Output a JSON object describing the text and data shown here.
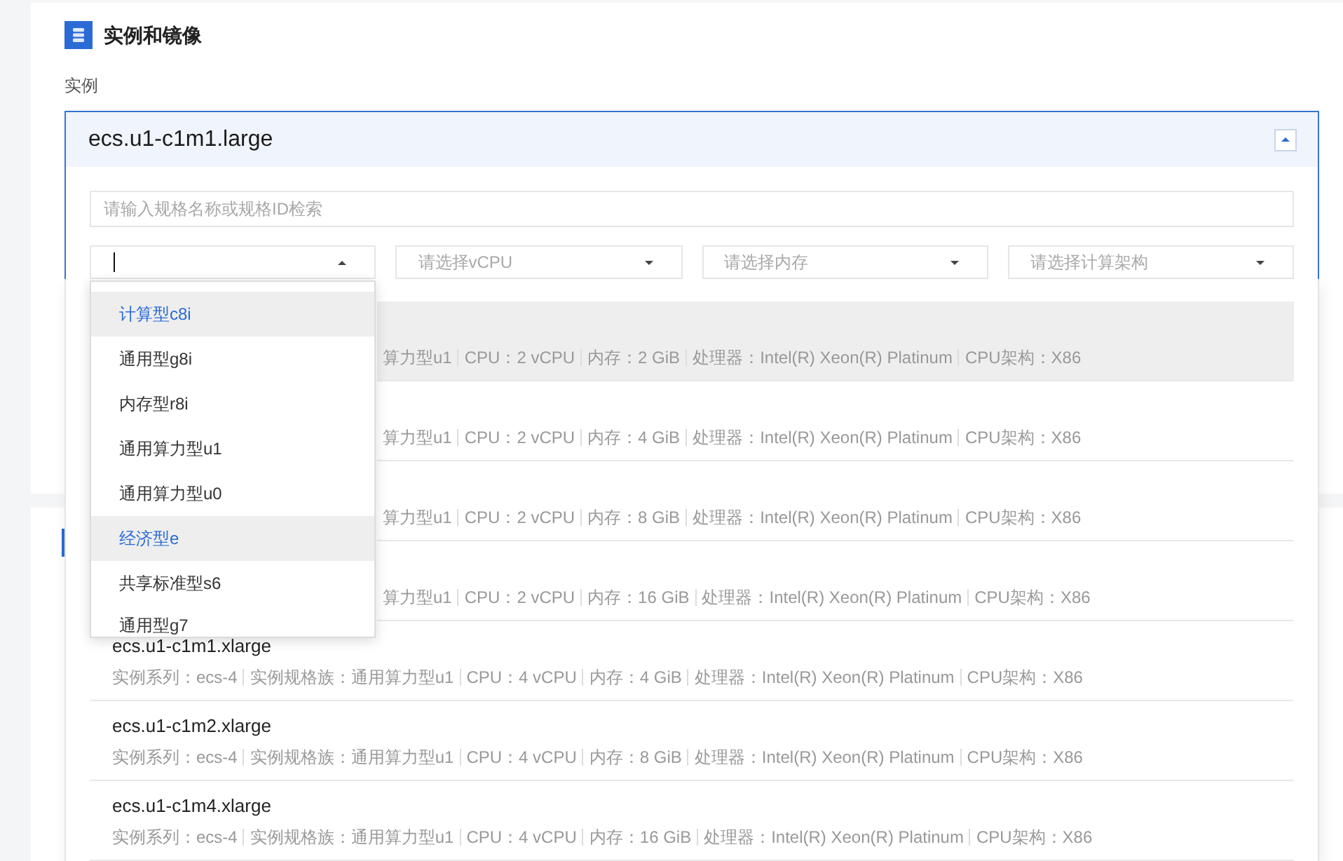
{
  "section": {
    "title": "实例和镜像"
  },
  "field_label": "实例",
  "spec_picker": {
    "value": "ecs.u1-c1m1.large",
    "expanded": true,
    "search": {
      "placeholder": "请输入规格名称或规格ID检索"
    },
    "filters": [
      {
        "focused": true,
        "open": true,
        "options": [
          {
            "label": "计算型c8i",
            "selected": true
          },
          {
            "label": "通用型g8i",
            "selected": false
          },
          {
            "label": "内存型r8i",
            "selected": false
          },
          {
            "label": "通用算力型u1",
            "selected": false
          },
          {
            "label": "通用算力型u0",
            "selected": false
          },
          {
            "label": "经济型e",
            "selected": true
          },
          {
            "label": "共享标准型s6",
            "selected": false
          },
          {
            "label": "通用型g7",
            "selected": false
          }
        ]
      },
      {
        "placeholder": "请选择vCPU",
        "focused": false,
        "open": false
      },
      {
        "placeholder": "请选择内存",
        "focused": false,
        "open": false
      },
      {
        "placeholder": "请选择计算架构",
        "focused": false,
        "open": false
      }
    ],
    "specs": [
      {
        "hovered": true,
        "fields": [
          "算力型u1",
          "CPU：2 vCPU",
          "内存：2 GiB",
          "处理器：Intel(R) Xeon(R) Platinum",
          "CPU架构：X86"
        ]
      },
      {
        "hovered": false,
        "fields": [
          "算力型u1",
          "CPU：2 vCPU",
          "内存：4 GiB",
          "处理器：Intel(R) Xeon(R) Platinum",
          "CPU架构：X86"
        ]
      },
      {
        "hovered": false,
        "fields": [
          "算力型u1",
          "CPU：2 vCPU",
          "内存：8 GiB",
          "处理器：Intel(R) Xeon(R) Platinum",
          "CPU架构：X86"
        ]
      },
      {
        "hovered": false,
        "fields": [
          "算力型u1",
          "CPU：2 vCPU",
          "内存：16 GiB",
          "处理器：Intel(R) Xeon(R) Platinum",
          "CPU架构：X86"
        ]
      },
      {
        "name": "ecs.u1-c1m1.xlarge",
        "hovered": false,
        "fields": [
          "实例系列：ecs-4",
          "实例规格族：通用算力型u1",
          "CPU：4 vCPU",
          "内存：4 GiB",
          "处理器：Intel(R) Xeon(R) Platinum",
          "CPU架构：X86"
        ]
      },
      {
        "name": "ecs.u1-c1m2.xlarge",
        "hovered": false,
        "fields": [
          "实例系列：ecs-4",
          "实例规格族：通用算力型u1",
          "CPU：4 vCPU",
          "内存：8 GiB",
          "处理器：Intel(R) Xeon(R) Platinum",
          "CPU架构：X86"
        ]
      },
      {
        "name": "ecs.u1-c1m4.xlarge",
        "hovered": false,
        "fields": [
          "实例系列：ecs-4",
          "实例规格族：通用算力型u1",
          "CPU：4 vCPU",
          "内存：16 GiB",
          "处理器：Intel(R) Xeon(R) Platinum",
          "CPU架构：X86"
        ]
      }
    ]
  }
}
